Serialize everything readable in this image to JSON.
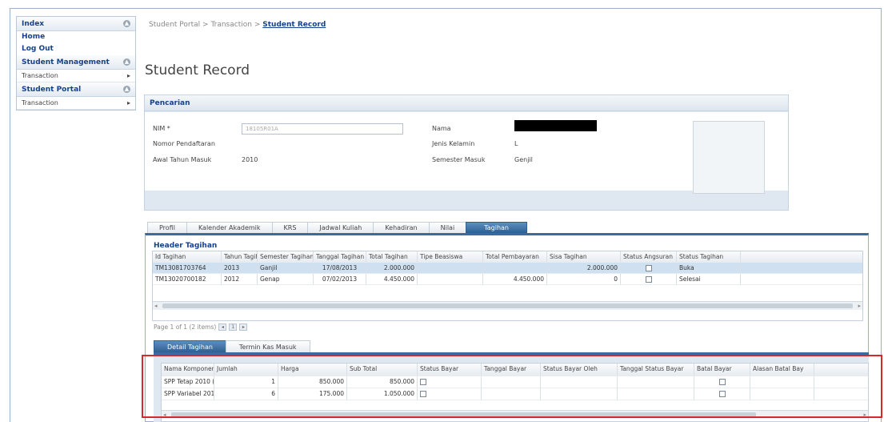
{
  "sidebar": {
    "index_title": "Index",
    "links": [
      "Home",
      "Log Out"
    ],
    "sections": [
      {
        "title": "Student Management",
        "items": [
          "Transaction"
        ]
      },
      {
        "title": "Student Portal",
        "items": [
          "Transaction"
        ]
      }
    ]
  },
  "breadcrumb": {
    "part1": "Student Portal",
    "sep": ">",
    "part2": "Transaction",
    "current": "Student Record"
  },
  "page_title": "Student Record",
  "search": {
    "title": "Pencarian",
    "nim_label": "NIM *",
    "nim_value": "18105R01A",
    "nomor_label": "Nomor Pendaftaran",
    "awal_label": "Awal Tahun Masuk",
    "awal_value": "2010",
    "nama_label": "Nama",
    "jk_label": "Jenis Kelamin",
    "jk_value": "L",
    "sem_label": "Semester Masuk",
    "sem_value": "Genjil"
  },
  "tabs": [
    "Profil",
    "Kalender Akademik",
    "KRS",
    "Jadwal Kuliah",
    "Kehadiran",
    "Nilai",
    "Tagihan"
  ],
  "active_tab": "Tagihan",
  "header_tagihan": {
    "title": "Header Tagihan",
    "columns": [
      "Id Tagihan",
      "Tahun Tagih",
      "Semester Tagihan",
      "Tanggal Tagihan",
      "Total Tagihan",
      "Tipe Beasiswa",
      "Total Pembayaran",
      "Sisa Tagihan",
      "Status Angsuran",
      "Status Tagihan"
    ],
    "rows": [
      [
        "TM13081703764",
        "2013",
        "Ganjil",
        "17/08/2013",
        "2.000.000",
        "",
        "",
        "2.000.000",
        "",
        "Buka"
      ],
      [
        "TM13020700182",
        "2012",
        "Genap",
        "07/02/2013",
        "4.450.000",
        "",
        "4.450.000",
        "0",
        "",
        "Selesai"
      ]
    ]
  },
  "pager_text": "Page 1 of 1 (2 items)",
  "pager_page": "1",
  "subtabs": [
    "Detail Tagihan",
    "Termin Kas Masuk"
  ],
  "detail": {
    "columns": [
      "Nama Komponen",
      "Jumlah",
      "Harga",
      "Sub Total",
      "Status Bayar",
      "Tanggal Bayar",
      "Status Bayar Oleh",
      "Tanggal Status Bayar",
      "Batal Bayar",
      "Alasan Batal Bay"
    ],
    "rows": [
      [
        "SPP Tetap 2010 (",
        "1",
        "850.000",
        "850.000",
        "",
        "",
        "",
        "",
        "",
        ""
      ],
      [
        "SPP Variabel 201",
        "6",
        "175.000",
        "1.050.000",
        "",
        "",
        "",
        "",
        "",
        ""
      ]
    ]
  }
}
